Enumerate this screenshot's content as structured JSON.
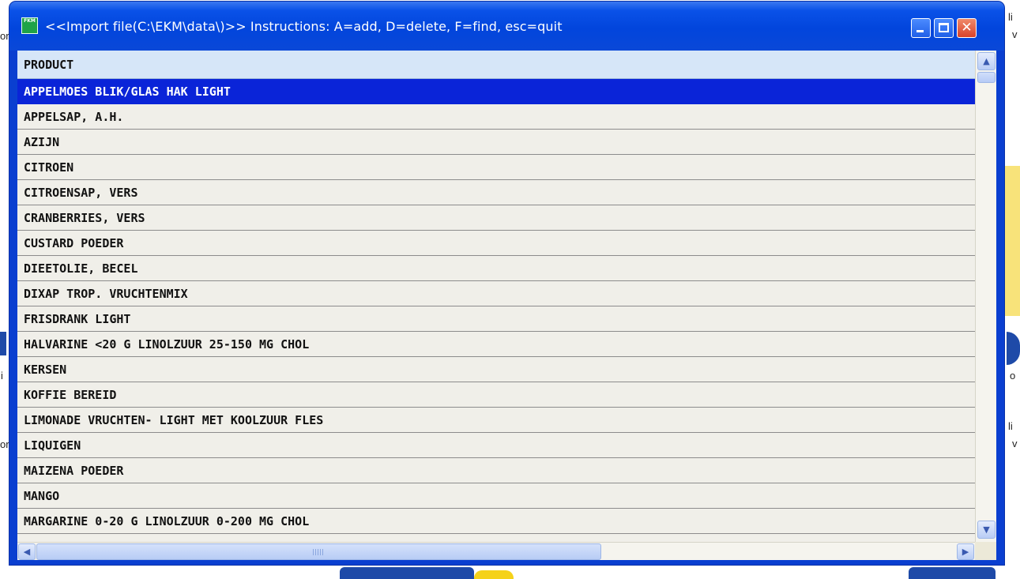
{
  "window": {
    "title": "<<Import file(C:\\EKM\\data\\)>>  Instructions:  A=add, D=delete, F=find, esc=quit",
    "icon_label": "FKM",
    "title_bar_color": "#0a48d8",
    "selected_row_color": "#0a24d8"
  },
  "buttons": {
    "minimize": "_",
    "maximize": "□",
    "close": "✕"
  },
  "table": {
    "column_header": "PRODUCT",
    "rows": [
      "APPELMOES BLIK/GLAS HAK LIGHT",
      "APPELSAP, A.H.",
      "AZIJN",
      "CITROEN",
      "CITROENSAP, VERS",
      "CRANBERRIES, VERS",
      "CUSTARD POEDER",
      "DIEETOLIE, BECEL",
      "DIXAP TROP. VRUCHTENMIX",
      "FRISDRANK LIGHT",
      "HALVARINE <20 G LINOLZUUR 25-150 MG CHOL",
      "KERSEN",
      "KOFFIE BEREID",
      "LIMONADE VRUCHTEN- LIGHT MET KOOLZUUR FLES",
      "LIQUIGEN",
      "MAIZENA POEDER",
      "MANGO",
      "MARGARINE 0-20 G LINOLZUUR 0-200 MG CHOL"
    ],
    "selected_index": 0
  },
  "background_fragments": [
    "li",
    "v",
    "li",
    "v",
    "o",
    "i",
    "i",
    "or",
    "or"
  ],
  "icons": [
    "app-icon",
    "minimize-icon",
    "maximize-icon",
    "close-icon",
    "scroll-up-icon",
    "scroll-down-icon",
    "scroll-left-icon",
    "scroll-right-icon"
  ]
}
